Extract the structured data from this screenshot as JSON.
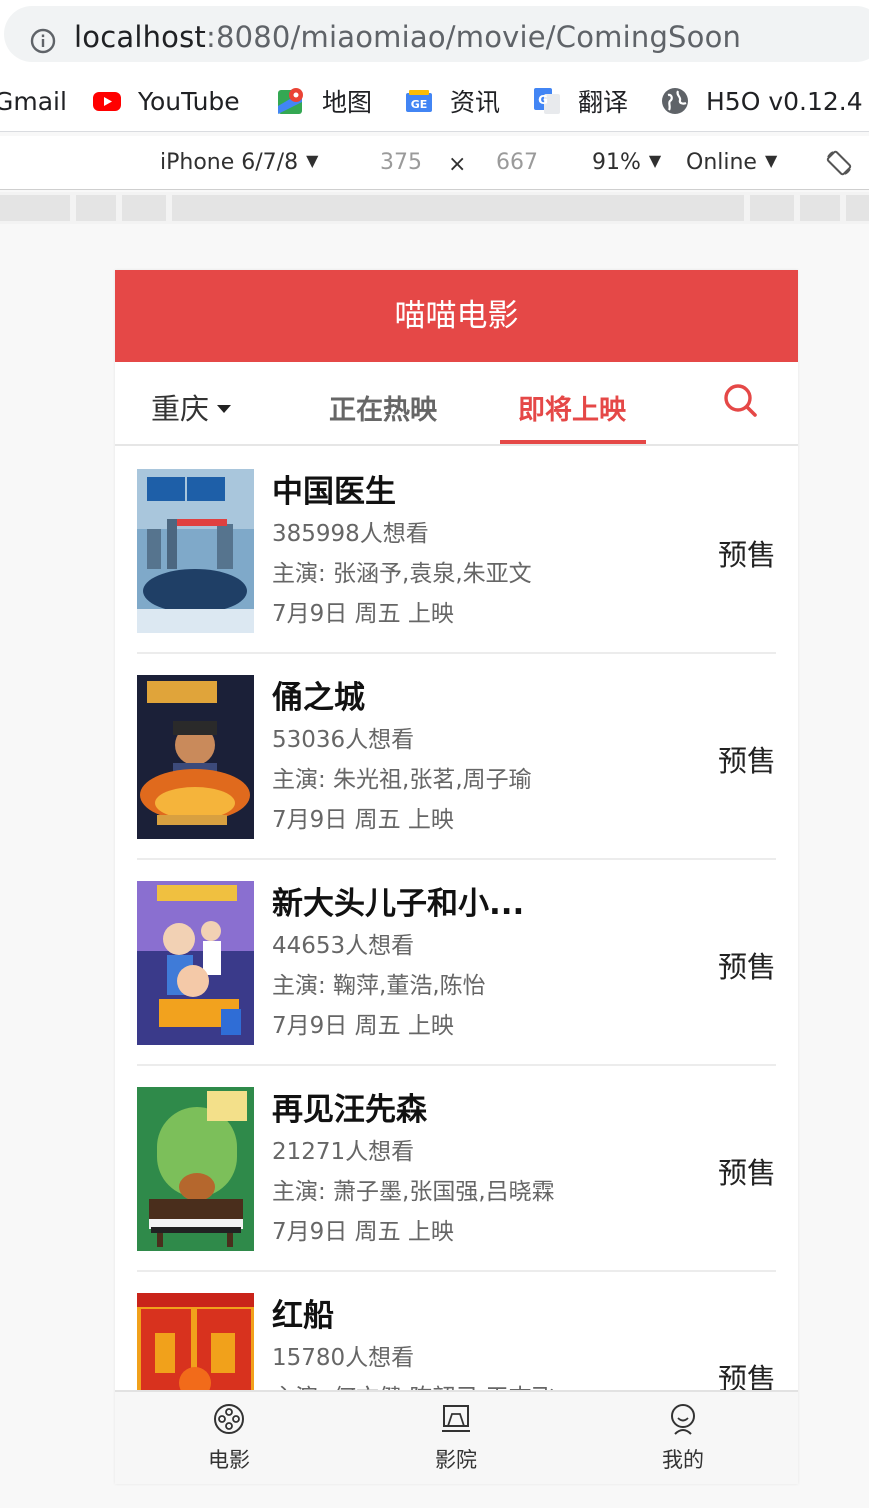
{
  "browser": {
    "url_host": "localhost",
    "url_rest": ":8080/miaomiao/movie/ComingSoon",
    "bookmarks": [
      "Gmail",
      "YouTube",
      "地图",
      "资讯",
      "翻译",
      "H5O v0.12.4"
    ]
  },
  "devtools": {
    "device": "iPhone 6/7/8",
    "width": "375",
    "times": "×",
    "height": "667",
    "zoom": "91%",
    "network": "Online"
  },
  "app": {
    "title": "喵喵电影",
    "city": "重庆",
    "tabs": [
      "正在热映",
      "即将上映"
    ],
    "active_tab": "即将上映",
    "movies": [
      {
        "title": "中国医生",
        "wish": "385998人想看",
        "actors": "主演: 张涵予,袁泉,朱亚文",
        "date": "7月9日 周五 上映",
        "action": "预售"
      },
      {
        "title": "俑之城",
        "wish": "53036人想看",
        "actors": "主演: 朱光祖,张茗,周子瑜",
        "date": "7月9日 周五 上映",
        "action": "预售"
      },
      {
        "title": "新大头儿子和小...",
        "wish": "44653人想看",
        "actors": "主演: 鞠萍,董浩,陈怡",
        "date": "7月9日 周五 上映",
        "action": "预售"
      },
      {
        "title": "再见汪先森",
        "wish": "21271人想看",
        "actors": "主演: 萧子墨,张国强,吕晓霖",
        "date": "7月9日 周五 上映",
        "action": "预售"
      },
      {
        "title": "红船",
        "wish": "15780人想看",
        "actors": "主演: 何文健,陈韶己,王志飞",
        "date": "",
        "action": "预售"
      }
    ],
    "tabbar": [
      "电影",
      "影院",
      "我的"
    ]
  },
  "colors": {
    "brand": "#e54847"
  }
}
